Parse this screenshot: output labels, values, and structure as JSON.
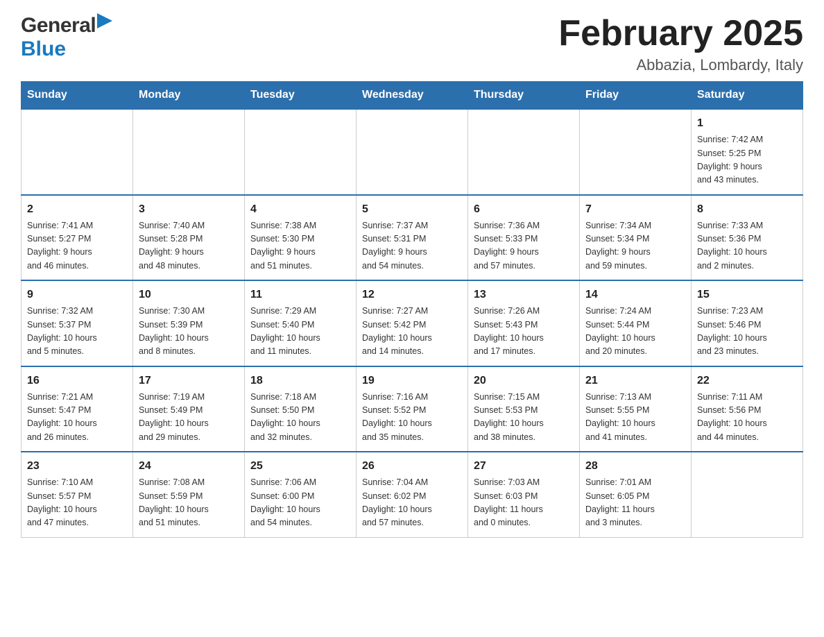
{
  "header": {
    "logo_general": "General",
    "logo_blue": "Blue",
    "month": "February 2025",
    "location": "Abbazia, Lombardy, Italy"
  },
  "weekdays": [
    "Sunday",
    "Monday",
    "Tuesday",
    "Wednesday",
    "Thursday",
    "Friday",
    "Saturday"
  ],
  "weeks": [
    [
      {
        "day": "",
        "info": ""
      },
      {
        "day": "",
        "info": ""
      },
      {
        "day": "",
        "info": ""
      },
      {
        "day": "",
        "info": ""
      },
      {
        "day": "",
        "info": ""
      },
      {
        "day": "",
        "info": ""
      },
      {
        "day": "1",
        "info": "Sunrise: 7:42 AM\nSunset: 5:25 PM\nDaylight: 9 hours\nand 43 minutes."
      }
    ],
    [
      {
        "day": "2",
        "info": "Sunrise: 7:41 AM\nSunset: 5:27 PM\nDaylight: 9 hours\nand 46 minutes."
      },
      {
        "day": "3",
        "info": "Sunrise: 7:40 AM\nSunset: 5:28 PM\nDaylight: 9 hours\nand 48 minutes."
      },
      {
        "day": "4",
        "info": "Sunrise: 7:38 AM\nSunset: 5:30 PM\nDaylight: 9 hours\nand 51 minutes."
      },
      {
        "day": "5",
        "info": "Sunrise: 7:37 AM\nSunset: 5:31 PM\nDaylight: 9 hours\nand 54 minutes."
      },
      {
        "day": "6",
        "info": "Sunrise: 7:36 AM\nSunset: 5:33 PM\nDaylight: 9 hours\nand 57 minutes."
      },
      {
        "day": "7",
        "info": "Sunrise: 7:34 AM\nSunset: 5:34 PM\nDaylight: 9 hours\nand 59 minutes."
      },
      {
        "day": "8",
        "info": "Sunrise: 7:33 AM\nSunset: 5:36 PM\nDaylight: 10 hours\nand 2 minutes."
      }
    ],
    [
      {
        "day": "9",
        "info": "Sunrise: 7:32 AM\nSunset: 5:37 PM\nDaylight: 10 hours\nand 5 minutes."
      },
      {
        "day": "10",
        "info": "Sunrise: 7:30 AM\nSunset: 5:39 PM\nDaylight: 10 hours\nand 8 minutes."
      },
      {
        "day": "11",
        "info": "Sunrise: 7:29 AM\nSunset: 5:40 PM\nDaylight: 10 hours\nand 11 minutes."
      },
      {
        "day": "12",
        "info": "Sunrise: 7:27 AM\nSunset: 5:42 PM\nDaylight: 10 hours\nand 14 minutes."
      },
      {
        "day": "13",
        "info": "Sunrise: 7:26 AM\nSunset: 5:43 PM\nDaylight: 10 hours\nand 17 minutes."
      },
      {
        "day": "14",
        "info": "Sunrise: 7:24 AM\nSunset: 5:44 PM\nDaylight: 10 hours\nand 20 minutes."
      },
      {
        "day": "15",
        "info": "Sunrise: 7:23 AM\nSunset: 5:46 PM\nDaylight: 10 hours\nand 23 minutes."
      }
    ],
    [
      {
        "day": "16",
        "info": "Sunrise: 7:21 AM\nSunset: 5:47 PM\nDaylight: 10 hours\nand 26 minutes."
      },
      {
        "day": "17",
        "info": "Sunrise: 7:19 AM\nSunset: 5:49 PM\nDaylight: 10 hours\nand 29 minutes."
      },
      {
        "day": "18",
        "info": "Sunrise: 7:18 AM\nSunset: 5:50 PM\nDaylight: 10 hours\nand 32 minutes."
      },
      {
        "day": "19",
        "info": "Sunrise: 7:16 AM\nSunset: 5:52 PM\nDaylight: 10 hours\nand 35 minutes."
      },
      {
        "day": "20",
        "info": "Sunrise: 7:15 AM\nSunset: 5:53 PM\nDaylight: 10 hours\nand 38 minutes."
      },
      {
        "day": "21",
        "info": "Sunrise: 7:13 AM\nSunset: 5:55 PM\nDaylight: 10 hours\nand 41 minutes."
      },
      {
        "day": "22",
        "info": "Sunrise: 7:11 AM\nSunset: 5:56 PM\nDaylight: 10 hours\nand 44 minutes."
      }
    ],
    [
      {
        "day": "23",
        "info": "Sunrise: 7:10 AM\nSunset: 5:57 PM\nDaylight: 10 hours\nand 47 minutes."
      },
      {
        "day": "24",
        "info": "Sunrise: 7:08 AM\nSunset: 5:59 PM\nDaylight: 10 hours\nand 51 minutes."
      },
      {
        "day": "25",
        "info": "Sunrise: 7:06 AM\nSunset: 6:00 PM\nDaylight: 10 hours\nand 54 minutes."
      },
      {
        "day": "26",
        "info": "Sunrise: 7:04 AM\nSunset: 6:02 PM\nDaylight: 10 hours\nand 57 minutes."
      },
      {
        "day": "27",
        "info": "Sunrise: 7:03 AM\nSunset: 6:03 PM\nDaylight: 11 hours\nand 0 minutes."
      },
      {
        "day": "28",
        "info": "Sunrise: 7:01 AM\nSunset: 6:05 PM\nDaylight: 11 hours\nand 3 minutes."
      },
      {
        "day": "",
        "info": ""
      }
    ]
  ]
}
